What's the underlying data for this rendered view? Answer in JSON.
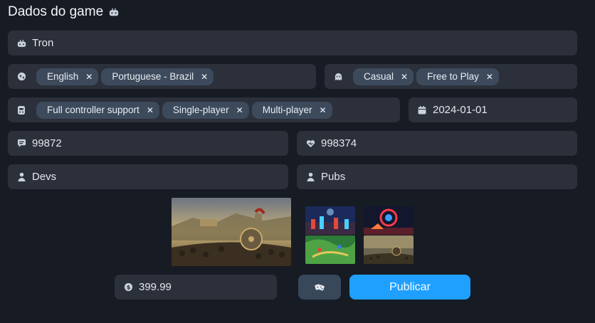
{
  "header": {
    "title": "Dados do game",
    "icon": "gamepad-icon"
  },
  "name_field": {
    "value": "Tron",
    "icon": "gamepad-icon"
  },
  "languages": {
    "icon": "globe-icon",
    "chips": [
      "English",
      "Portuguese - Brazil"
    ]
  },
  "genres": {
    "icon": "ghost-icon",
    "chips": [
      "Casual",
      "Free to Play"
    ]
  },
  "features": {
    "icon": "controller-icon",
    "chips": [
      "Full controller support",
      "Single-player",
      "Multi-player"
    ]
  },
  "release_date": {
    "icon": "calendar-icon",
    "value": "2024-01-01"
  },
  "stat_left": {
    "icon": "chat-icon",
    "value": "99872"
  },
  "stat_right": {
    "icon": "heart-icon",
    "value": "998374"
  },
  "developers": {
    "icon": "user-icon",
    "value": "Devs"
  },
  "publishers": {
    "icon": "user-icon",
    "value": "Pubs"
  },
  "media": {
    "cover": "spartan-warrior-image",
    "screenshots": [
      "cyber-battle-image",
      "sci-fi-explosion-image",
      "fantasy-map-image",
      "warrior-landscape-image"
    ]
  },
  "price": {
    "icon": "dollar-coin-icon",
    "value": "399.99"
  },
  "actions": {
    "random_icon": "dice-icon",
    "publish_label": "Publicar"
  },
  "colors": {
    "background": "#171b24",
    "field": "#2b303a",
    "chip": "#3c4a5c",
    "accent": "#1fa0ff"
  }
}
